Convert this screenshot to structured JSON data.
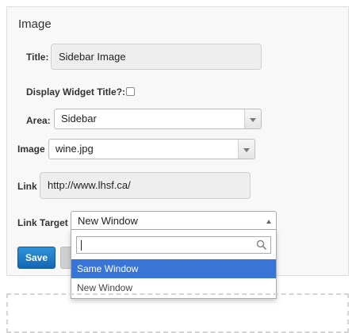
{
  "widget": {
    "title": "Image",
    "fields": {
      "title_label": "Title:",
      "title_value": "Sidebar Image",
      "display_label": "Display Widget Title?:",
      "area_label": "Area:",
      "area_value": "Sidebar",
      "image_label": "Image",
      "image_value": "wine.jpg",
      "link_label": "Link",
      "link_value": "http://www.lhsf.ca/",
      "target_label": "Link Target",
      "target_value": "New Window"
    },
    "save_label": "Save"
  },
  "dropdown": {
    "search_value": "",
    "options": [
      {
        "label": "Same Window",
        "highlighted": true
      },
      {
        "label": "New Window",
        "highlighted": false
      }
    ]
  },
  "colors": {
    "highlight": "#3875d7",
    "save_button": "#1e78c8"
  },
  "icons": [
    "chevron-down-icon",
    "chevron-up-icon",
    "search-icon"
  ]
}
